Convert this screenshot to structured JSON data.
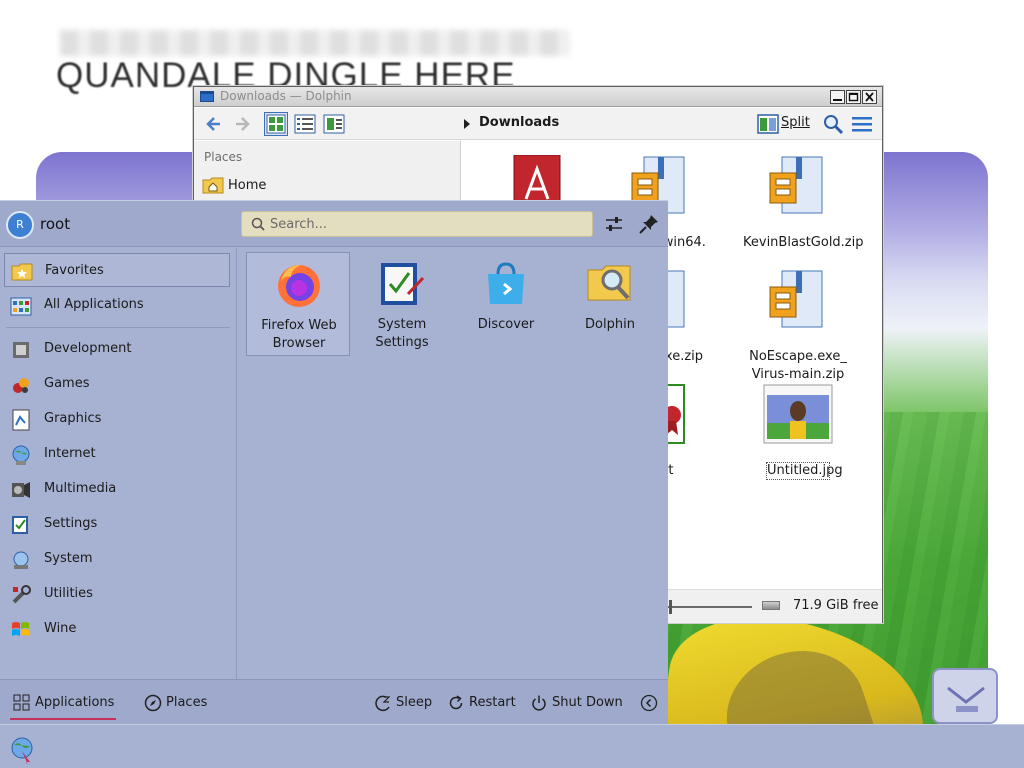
{
  "wallpaper": {
    "headline": "QUANDALE DINGLE HERE"
  },
  "dolphin": {
    "window_title": "Downloads — Dolphin",
    "breadcrumb": "Downloads",
    "split_label": "Split",
    "places": {
      "heading": "Places",
      "items": [
        {
          "label": "Home"
        }
      ]
    },
    "files": [
      {
        "name": "",
        "icon": "pdf-icon"
      },
      {
        "name": "…et-win64.\n…ip",
        "icon": "zip-icon"
      },
      {
        "name": "KevinBlastGold.zip",
        "icon": "zip-icon"
      },
      {
        "name": "…e.exe.zip",
        "icon": "zip-icon"
      },
      {
        "name": "NoEscape.exe_\nVirus-main.zip",
        "icon": "zip-icon"
      },
      {
        "name": "…s.crt",
        "icon": "certificate-icon"
      },
      {
        "name": "Untitled.jpg",
        "icon": "image-thumbnail"
      }
    ],
    "status": {
      "free_space": "71.9 GiB free"
    }
  },
  "launcher": {
    "user": {
      "initial": "R",
      "name": "root"
    },
    "search": {
      "placeholder": "Search..."
    },
    "categories": [
      {
        "label": "Favorites",
        "icon": "favorites-folder-icon"
      },
      {
        "label": "All Applications",
        "icon": "all-apps-icon"
      },
      {
        "label": "Development",
        "icon": "development-icon"
      },
      {
        "label": "Games",
        "icon": "games-icon"
      },
      {
        "label": "Graphics",
        "icon": "graphics-icon"
      },
      {
        "label": "Internet",
        "icon": "internet-icon"
      },
      {
        "label": "Multimedia",
        "icon": "multimedia-icon"
      },
      {
        "label": "Settings",
        "icon": "settings-icon"
      },
      {
        "label": "System",
        "icon": "system-icon"
      },
      {
        "label": "Utilities",
        "icon": "utilities-icon"
      },
      {
        "label": "Wine",
        "icon": "wine-icon"
      }
    ],
    "favorites": [
      {
        "label": "Firefox Web Browser",
        "icon": "firefox-icon"
      },
      {
        "label": "System Settings",
        "icon": "system-settings-icon"
      },
      {
        "label": "Discover",
        "icon": "discover-icon"
      },
      {
        "label": "Dolphin",
        "icon": "dolphin-icon"
      }
    ],
    "footer": {
      "applications": "Applications",
      "places": "Places",
      "sleep": "Sleep",
      "restart": "Restart",
      "shutdown": "Shut Down"
    }
  },
  "colors": {
    "accent": "#c4315a",
    "panel": "#a7b1d1",
    "search_bg": "#e4dec0"
  }
}
